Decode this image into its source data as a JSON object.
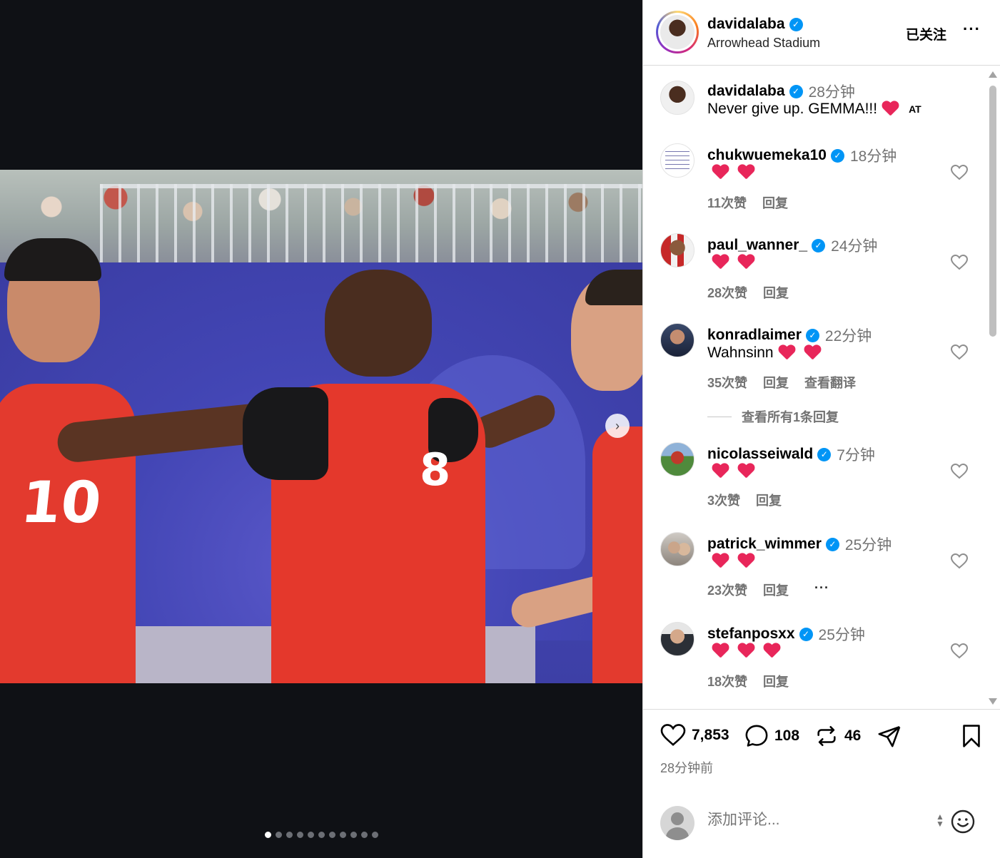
{
  "media": {
    "jersey_numbers": [
      "10",
      "8"
    ],
    "carousel": {
      "total": 11,
      "active_index": 0
    }
  },
  "header": {
    "username": "davidalaba",
    "location": "Arrowhead Stadium",
    "follow_label": "已关注",
    "more_label": "···"
  },
  "caption": {
    "username": "davidalaba",
    "time": "28分钟",
    "text": "Never give up. GEMMA!!!",
    "suffix": "AT"
  },
  "comments": [
    {
      "username": "chukwuemeka10",
      "time": "18分钟",
      "text": "",
      "hearts": 2,
      "likes": "11次赞",
      "reply": "回复"
    },
    {
      "username": "paul_wanner_",
      "time": "24分钟",
      "text": "",
      "hearts": 2,
      "likes": "28次赞",
      "reply": "回复"
    },
    {
      "username": "konradlaimer",
      "time": "22分钟",
      "text": "Wahnsinn",
      "hearts": 2,
      "likes": "35次赞",
      "reply": "回复",
      "translate": "查看翻译",
      "view_replies": "查看所有1条回复"
    },
    {
      "username": "nicolasseiwald",
      "time": "7分钟",
      "text": "",
      "hearts": 2,
      "likes": "3次赞",
      "reply": "回复"
    },
    {
      "username": "patrick_wimmer",
      "time": "25分钟",
      "text": "",
      "hearts": 2,
      "likes": "23次赞",
      "reply": "回复",
      "more": "···"
    },
    {
      "username": "stefanposxx",
      "time": "25分钟",
      "text": "",
      "hearts": 3,
      "likes": "18次赞",
      "reply": "回复"
    }
  ],
  "actions": {
    "likes": "7,853",
    "comments": "108",
    "reposts": "46",
    "posted": "28分钟前"
  },
  "add_comment": {
    "placeholder": "添加评论..."
  },
  "colors": {
    "verified": "#0095f6",
    "heart_emoji": "#e8265a",
    "muted_text": "#737373",
    "media_bg": "#0f1115"
  }
}
